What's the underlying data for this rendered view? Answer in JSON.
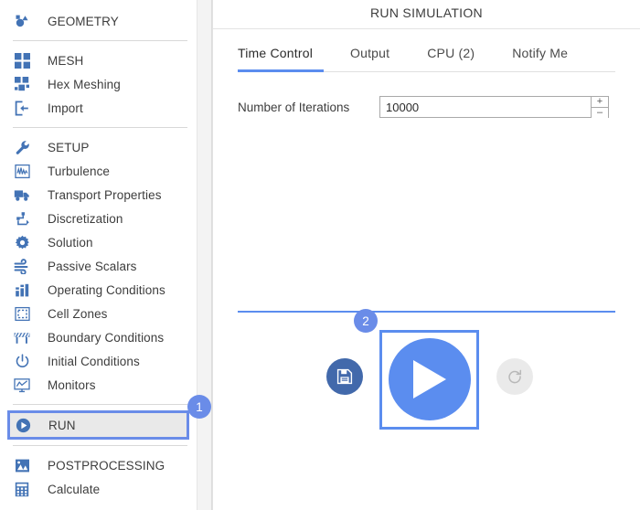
{
  "sidebar": {
    "groups": [
      {
        "items": [
          {
            "label": "GEOMETRY",
            "icon": "geometry-icon",
            "is_header": true
          }
        ]
      },
      {
        "items": [
          {
            "label": "MESH",
            "icon": "mesh-grid-icon",
            "is_header": true
          },
          {
            "label": "Hex Meshing",
            "icon": "hex-meshing-icon",
            "is_header": false
          },
          {
            "label": "Import",
            "icon": "import-icon",
            "is_header": false
          }
        ]
      },
      {
        "items": [
          {
            "label": "SETUP",
            "icon": "wrench-icon",
            "is_header": true
          },
          {
            "label": "Turbulence",
            "icon": "turbulence-icon",
            "is_header": false
          },
          {
            "label": "Transport Properties",
            "icon": "truck-icon",
            "is_header": false
          },
          {
            "label": "Discretization",
            "icon": "discretization-icon",
            "is_header": false
          },
          {
            "label": "Solution",
            "icon": "gear-icon",
            "is_header": false
          },
          {
            "label": "Passive Scalars",
            "icon": "wind-icon",
            "is_header": false
          },
          {
            "label": "Operating Conditions",
            "icon": "bar-chart-icon",
            "is_header": false
          },
          {
            "label": "Cell Zones",
            "icon": "cell-zones-icon",
            "is_header": false
          },
          {
            "label": "Boundary Conditions",
            "icon": "barrier-icon",
            "is_header": false
          },
          {
            "label": "Initial Conditions",
            "icon": "power-icon",
            "is_header": false
          },
          {
            "label": "Monitors",
            "icon": "monitor-icon",
            "is_header": false
          }
        ]
      },
      {
        "items": [
          {
            "label": "RUN",
            "icon": "play-circle-icon",
            "is_header": true,
            "selected": true
          }
        ]
      },
      {
        "items": [
          {
            "label": "POSTPROCESSING",
            "icon": "postprocessing-icon",
            "is_header": true
          },
          {
            "label": "Calculate",
            "icon": "calculator-icon",
            "is_header": false
          }
        ]
      }
    ]
  },
  "main": {
    "title": "RUN SIMULATION",
    "tabs": [
      {
        "label": "Time Control",
        "active": true
      },
      {
        "label": "Output",
        "active": false
      },
      {
        "label": "CPU  (2)",
        "active": false
      },
      {
        "label": "Notify Me",
        "active": false
      }
    ],
    "form": {
      "iterations_label": "Number of Iterations",
      "iterations_value": "10000",
      "iterations_placeholder": "",
      "spinner_up": "+",
      "spinner_down": "–"
    },
    "controls": {
      "save_icon": "save-floppy-icon",
      "play_icon": "play-triangle-icon",
      "reset_icon": "reset-circular-arrow-icon"
    }
  },
  "annotations": {
    "badge_1": "1",
    "badge_2": "2"
  },
  "colors": {
    "accent_blue": "#5b8def",
    "badge_blue": "#6a8ce8",
    "icon_blue": "#4373b5",
    "save_blue": "#4269ab",
    "disabled_grey": "#eaeaea",
    "text": "#3d3d3d"
  }
}
